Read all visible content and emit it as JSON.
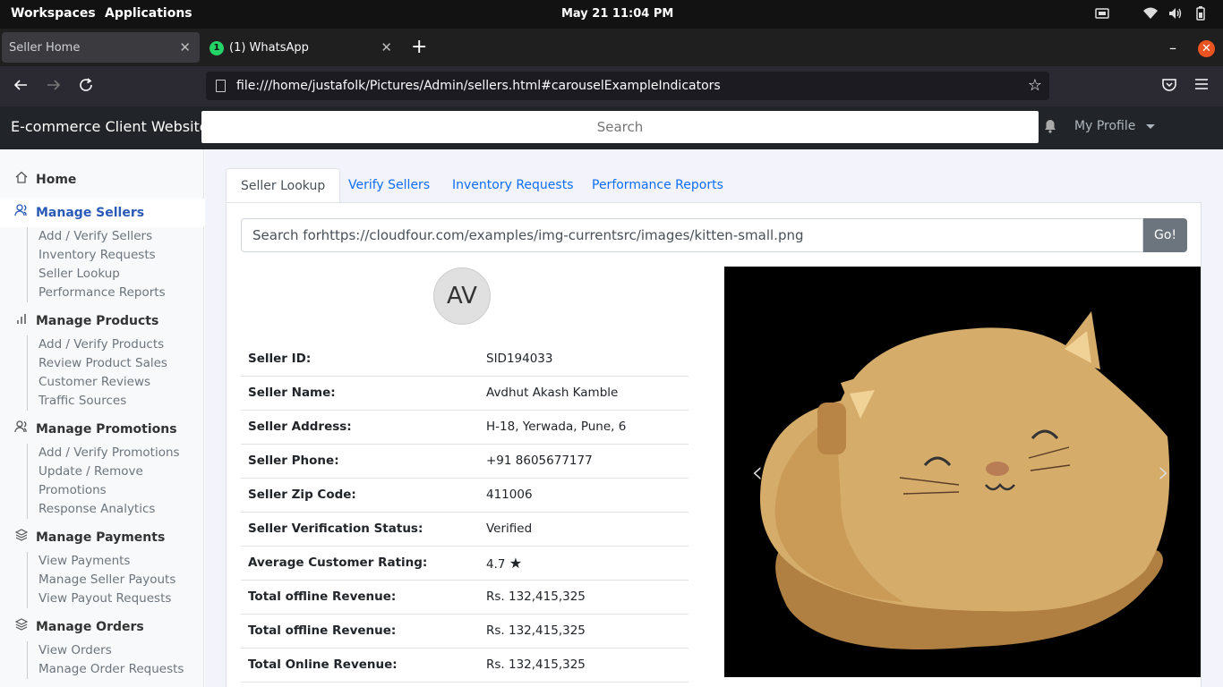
{
  "system_bar": {
    "workspaces": "Workspaces",
    "applications": "Applications",
    "datetime": "May 21  11:04 PM"
  },
  "browser": {
    "tabs": [
      {
        "title": "Seller Home",
        "active": true
      },
      {
        "title": "(1) WhatsApp",
        "active": false,
        "badge": "1"
      }
    ],
    "url": "file:///home/justafolk/Pictures/Admin/sellers.html#carouselExampleIndicators"
  },
  "app": {
    "brand": "E-commerce Client Website",
    "search_placeholder": "Search",
    "profile_label": "My Profile"
  },
  "sidebar": {
    "home": "Home",
    "sections": [
      {
        "label": "Manage Sellers",
        "icon": "users-icon",
        "active": true,
        "items": [
          "Add / Verify Sellers",
          "Inventory Requests",
          "Seller Lookup",
          "Performance Reports"
        ]
      },
      {
        "label": "Manage Products",
        "icon": "bar-chart-icon",
        "items": [
          "Add / Verify Products",
          "Review Product Sales",
          "Customer Reviews",
          "Traffic Sources"
        ]
      },
      {
        "label": "Manage Promotions",
        "icon": "users-icon",
        "items": [
          "Add / Verify Promotions",
          "Update / Remove",
          "Promotions",
          "Response Analytics"
        ]
      },
      {
        "label": "Manage Payments",
        "icon": "layers-icon",
        "items": [
          "View Payments",
          "Manage Seller Payouts",
          "View Payout Requests"
        ]
      },
      {
        "label": "Manage Orders",
        "icon": "layers-icon",
        "items": [
          "View Orders",
          "Manage Order Requests"
        ]
      }
    ]
  },
  "main": {
    "tabs": [
      "Seller Lookup",
      "Verify Sellers",
      "Inventory Requests",
      "Performance Reports"
    ],
    "lookup_value": "Search forhttps://cloudfour.com/examples/img-currentsrc/images/kitten-small.png",
    "go_label": "Go!",
    "avatar_initials": "AV",
    "fields": [
      {
        "key": "Seller ID:",
        "value": "SID194033"
      },
      {
        "key": "Seller Name:",
        "value": "Avdhut Akash Kamble"
      },
      {
        "key": "Seller Address:",
        "value": "H-18, Yerwada, Pune, 6"
      },
      {
        "key": "Seller Phone:",
        "value": "+91 8605677177"
      },
      {
        "key": "Seller Zip Code:",
        "value": "411006"
      },
      {
        "key": "Seller Verification Status:",
        "value": "Verified"
      },
      {
        "key": "Average Customer Rating:",
        "value": "4.7"
      },
      {
        "key": "Total offline Revenue:",
        "value": "Rs. 132,415,325"
      },
      {
        "key": "Total offline Revenue:",
        "value": "Rs. 132,415,325"
      },
      {
        "key": "Total Online Revenue:",
        "value": "Rs. 132,415,325"
      }
    ],
    "colors": {
      "verified": "#198754",
      "rating": "#ffc107",
      "link": "#0d6efd"
    }
  }
}
